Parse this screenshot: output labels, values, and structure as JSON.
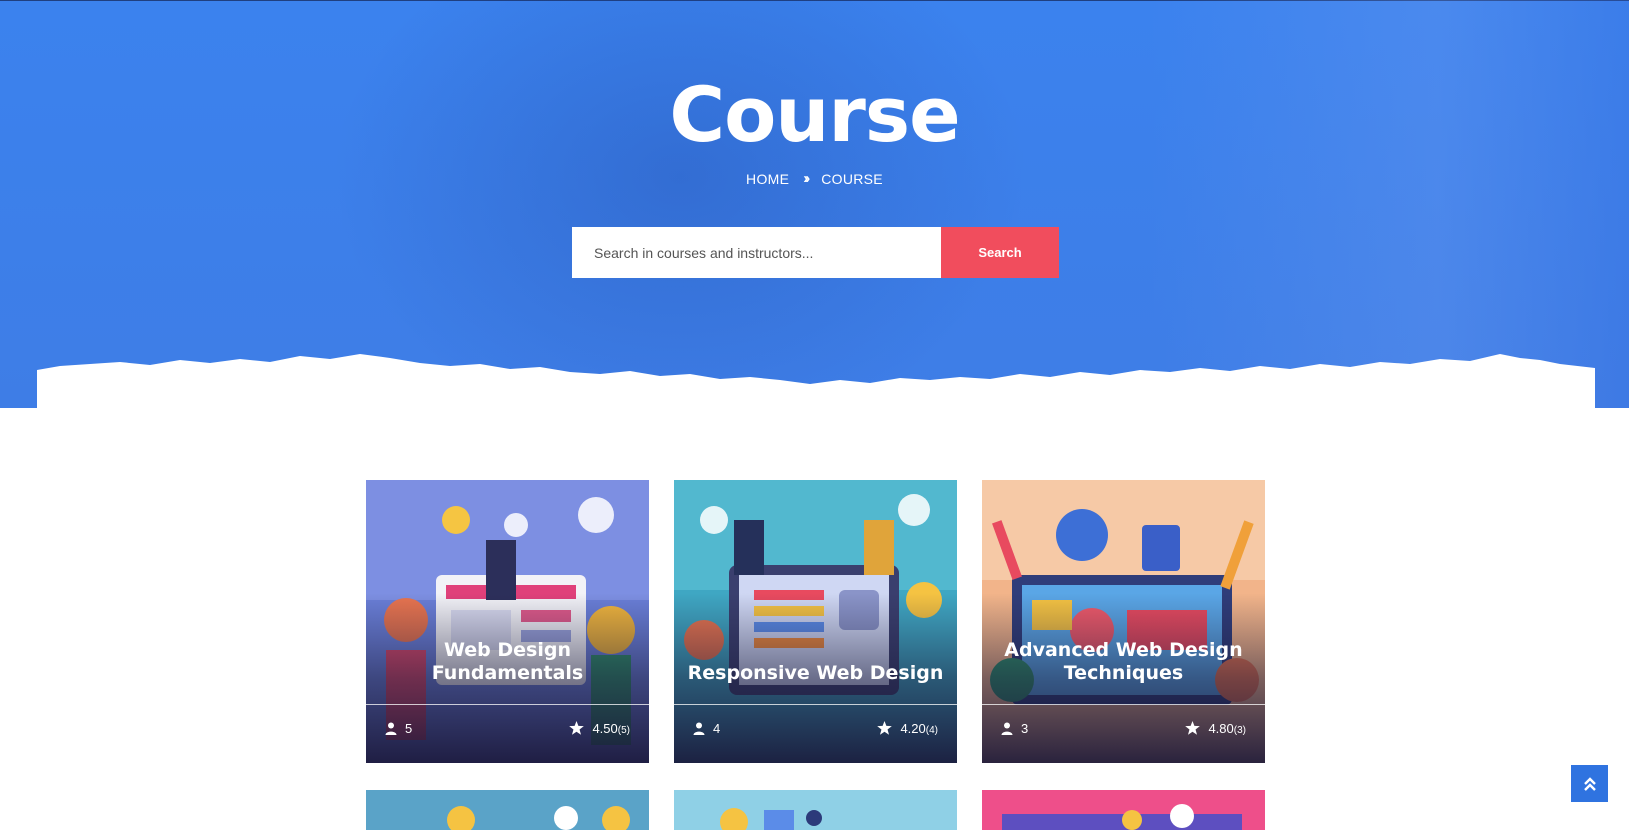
{
  "hero": {
    "title": "Course",
    "breadcrumb": {
      "home": "HOME",
      "separator": "»",
      "current": "COURSE"
    }
  },
  "search": {
    "placeholder": "Search in courses and instructors...",
    "button_label": "Search"
  },
  "colors": {
    "hero_blue": "#3b82ee",
    "search_button": "#f14d5d",
    "scroll_top": "#2f73e0"
  },
  "courses": [
    {
      "title": "Web Design Fundamentals",
      "students": "5",
      "rating": "4.50",
      "reviews": "(5)"
    },
    {
      "title": "Responsive Web Design",
      "students": "4",
      "rating": "4.20",
      "reviews": "(4)"
    },
    {
      "title": "Advanced Web Design Techniques",
      "students": "3",
      "rating": "4.80",
      "reviews": "(3)"
    }
  ],
  "icons": {
    "students": "user-icon",
    "rating": "star-icon",
    "scroll_top": "double-chevron-up-icon"
  }
}
